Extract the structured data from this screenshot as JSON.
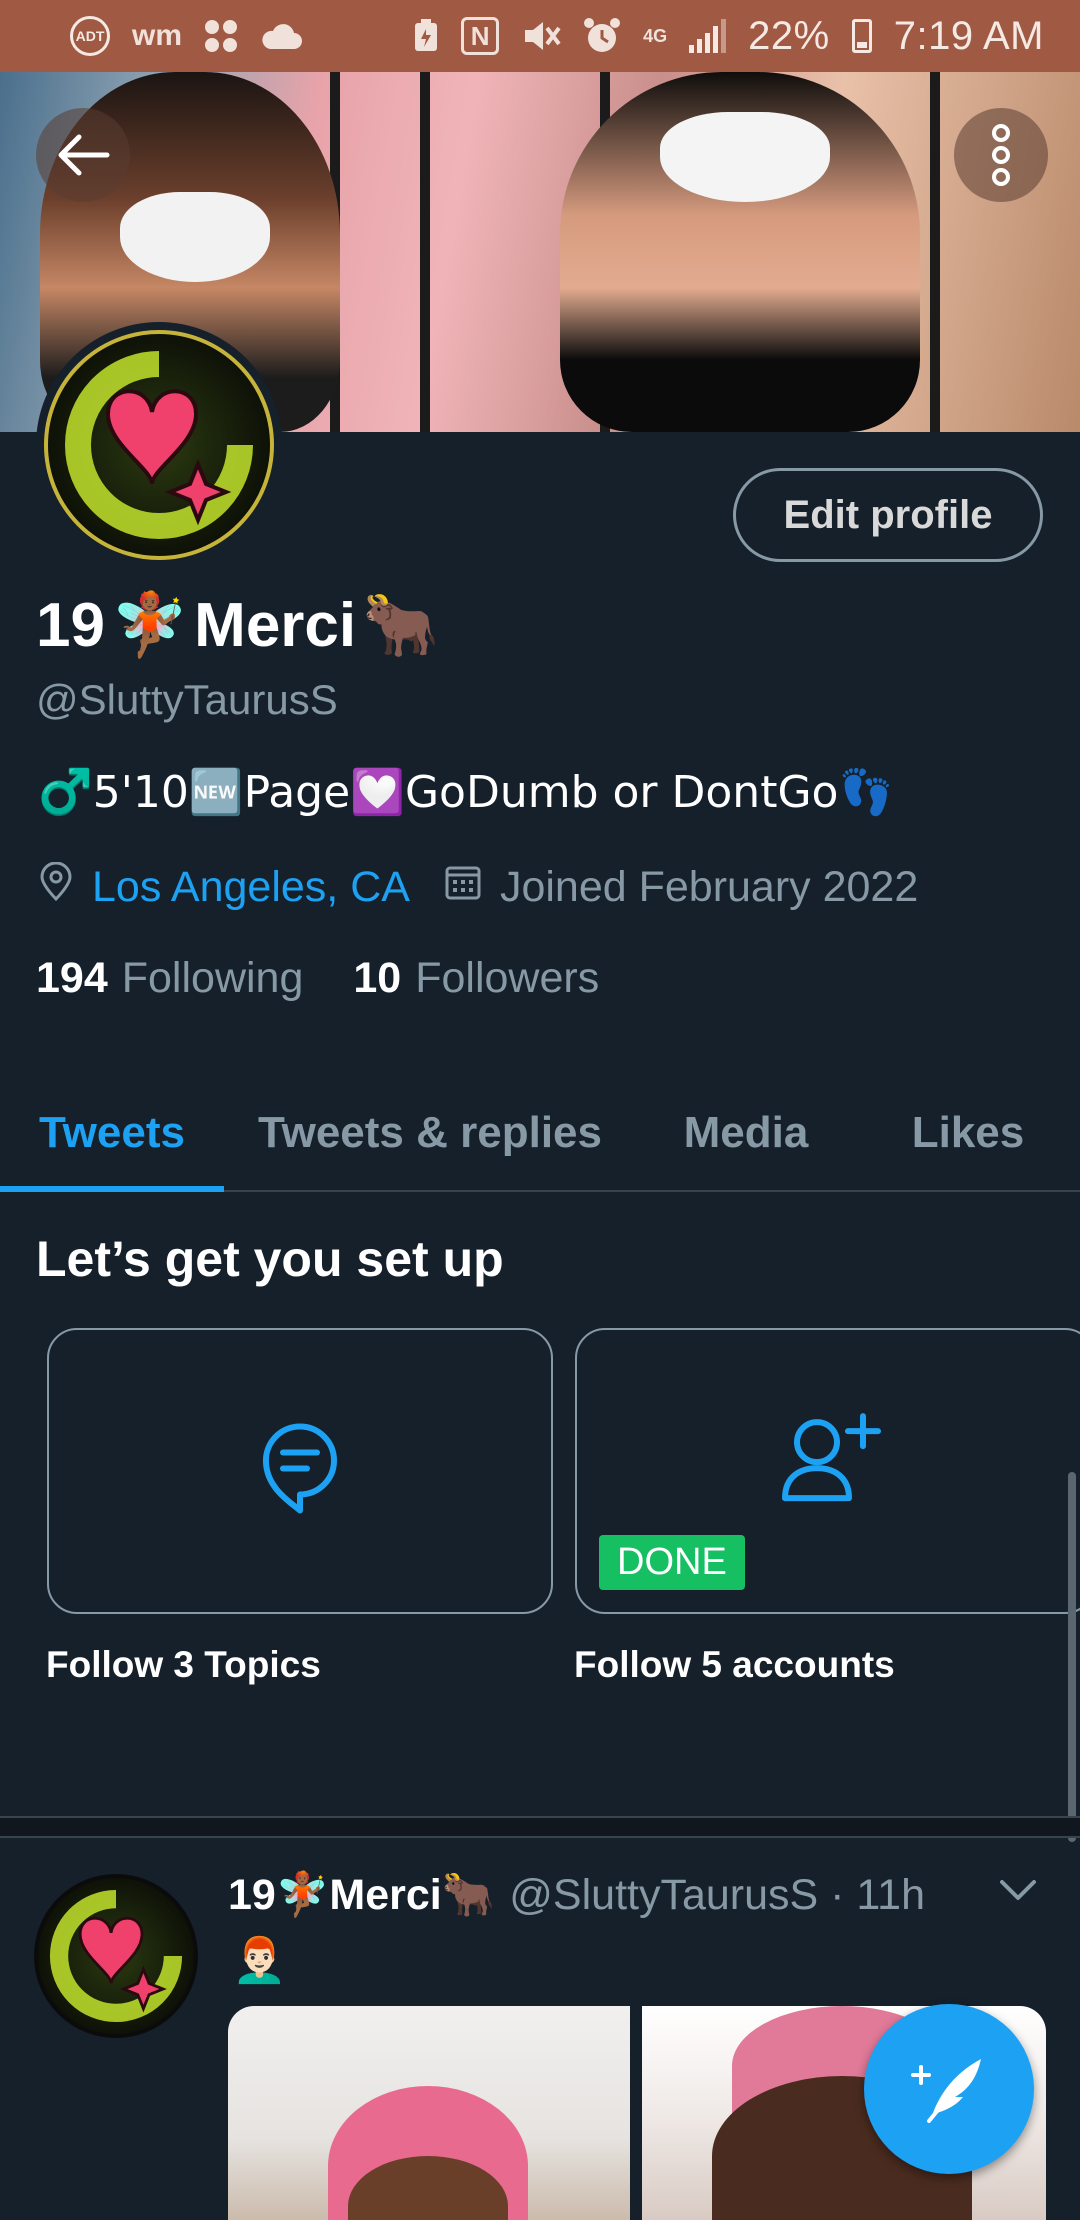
{
  "status_bar": {
    "left_icons": [
      "adt-icon",
      "wm-icon",
      "apps-grid-icon",
      "cloud-icon"
    ],
    "adt_label": "ADT",
    "wm_label": "wm",
    "right_icons": [
      "battery-saver-icon",
      "nfc-icon",
      "mute-icon",
      "alarm-icon",
      "lte-icon",
      "signal-icon"
    ],
    "nfc_label": "N",
    "lte_label": "4G",
    "battery": "22%",
    "time": "7:19 AM"
  },
  "header": {
    "back_icon": "arrow-left-icon",
    "more_icon": "more-vertical-icon"
  },
  "profile": {
    "edit_label": "Edit profile",
    "name_prefix": "19",
    "name_mid": "Merci",
    "name_emoji_1": "🧚🏾",
    "name_emoji_2": "🐂",
    "handle": "@SluttyTaurusS",
    "bio": "♂️5'10🆕Page💟GoDumb or DontGo👣",
    "location": "Los Angeles, CA",
    "joined": "Joined February 2022",
    "following_count": "194",
    "following_label": "Following",
    "followers_count": "10",
    "followers_label": "Followers"
  },
  "tabs": [
    {
      "label": "Tweets",
      "active": true
    },
    {
      "label": "Tweets & replies",
      "active": false
    },
    {
      "label": "Media",
      "active": false
    },
    {
      "label": "Likes",
      "active": false
    }
  ],
  "setup": {
    "title": "Let’s get you set up",
    "cards": [
      {
        "label": "Follow 3 Topics",
        "icon": "topic-bubble-icon",
        "done": false
      },
      {
        "label": "Follow 5 accounts",
        "icon": "add-user-icon",
        "done": true,
        "badge": "DONE"
      }
    ]
  },
  "tweet": {
    "name_prefix": "19",
    "name_mid": "Merci",
    "handle_time": "@SluttyTaurusS · 11h",
    "text": "👨🏻‍🦰",
    "chevron_icon": "chevron-down-icon"
  },
  "compose": {
    "icon": "compose-feather-icon"
  },
  "colors": {
    "background": "#15202b",
    "accent": "#1da1f2",
    "muted": "#8899a6",
    "done_green": "#17bf63",
    "status_bar": "#a05a44"
  }
}
